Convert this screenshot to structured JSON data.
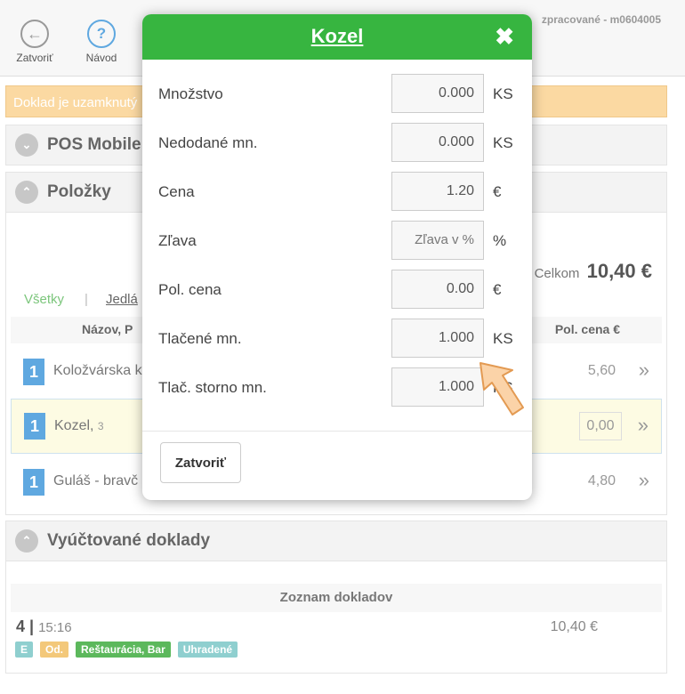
{
  "toolbar": {
    "close_label": "Zatvoriť",
    "help_label": "Návod",
    "status": "nezpracované - m0604005",
    "status_visible": "zpracované - m0604005"
  },
  "banner": {
    "text": "Doklad je uzamknutý"
  },
  "sections": {
    "pos": "POS Mobile",
    "items": "Položky",
    "billed": "Vyúčtované doklady"
  },
  "totals": {
    "label": "Celkom",
    "value": "10,40 €"
  },
  "filters": {
    "all": "Všetky",
    "sep": "|",
    "food": "Jedlá"
  },
  "table": {
    "col_name": "Názov, P",
    "col_price": "Pol. cena €"
  },
  "items": [
    {
      "qty": "1",
      "name": "Koložvárska k",
      "note": "",
      "price": "5,60"
    },
    {
      "qty": "1",
      "name": "Kozel,",
      "note": "3",
      "price": "0,00"
    },
    {
      "qty": "1",
      "name": "Guláš - bravč",
      "note": "",
      "price": "4,80"
    }
  ],
  "documents": {
    "header": "Zoznam dokladov",
    "list": [
      {
        "number": "4 |",
        "time": "15:16",
        "amount": "10,40 €",
        "tags": [
          {
            "text": "E",
            "color": "#8fcfcf"
          },
          {
            "text": "Od.",
            "color": "#f3c87a"
          },
          {
            "text": "Reštaurácia, Bar",
            "color": "#5cb85c"
          },
          {
            "text": "Uhradené",
            "color": "#8fcfcf"
          }
        ]
      }
    ]
  },
  "modal": {
    "title": "Kozel",
    "close_icon": "✖",
    "fields": [
      {
        "label": "Množstvo",
        "value": "0.000",
        "placeholder": "",
        "unit": "KS"
      },
      {
        "label": "Nedodané mn.",
        "value": "0.000",
        "placeholder": "",
        "unit": "KS"
      },
      {
        "label": "Cena",
        "value": "1.20",
        "placeholder": "",
        "unit": "€"
      },
      {
        "label": "Zľava",
        "value": "",
        "placeholder": "Zľava v %",
        "unit": "%"
      },
      {
        "label": "Pol. cena",
        "value": "0.00",
        "placeholder": "",
        "unit": "€"
      },
      {
        "label": "Tlačené mn.",
        "value": "1.000",
        "placeholder": "",
        "unit": "KS"
      },
      {
        "label": "Tlač. storno mn.",
        "value": "1.000",
        "placeholder": "",
        "unit": "KS"
      }
    ],
    "close_button": "Zatvoriť"
  },
  "colors": {
    "accent_green": "#37b540",
    "badge_blue": "#5fa8e0",
    "banner": "#fbd9a2"
  }
}
